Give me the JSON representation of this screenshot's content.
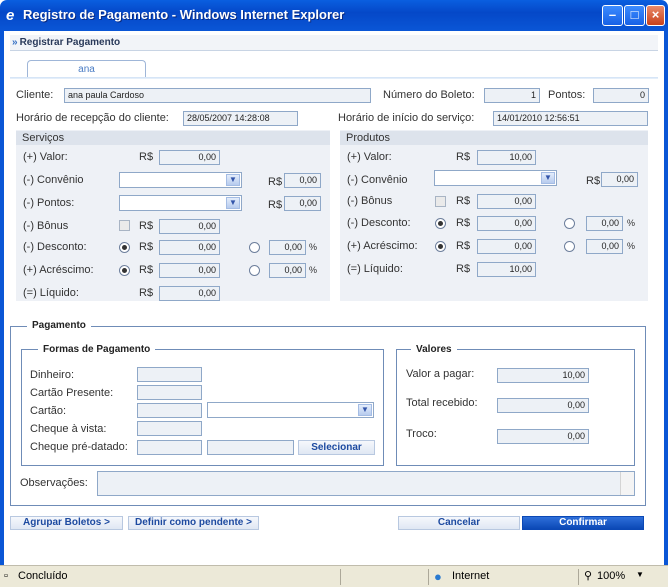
{
  "window": {
    "title": "Registro de Pagamento - Windows Internet Explorer"
  },
  "breadcrumb": "Registrar Pagamento",
  "tab": "ana",
  "header": {
    "cliente_label": "Cliente:",
    "cliente_value": "ana paula Cardoso",
    "boleto_label": "Número do Boleto:",
    "boleto_value": "1",
    "pontos_label": "Pontos:",
    "pontos_value": "0",
    "recepcao_label": "Horário de recepção do cliente:",
    "recepcao_value": "28/05/2007 14:28:08",
    "inicio_label": "Horário de início do serviço:",
    "inicio_value": "14/01/2010 12:56:51"
  },
  "servicos": {
    "title": "Serviços",
    "valor_label": "(+) Valor:",
    "valor_value": "0,00",
    "convenio_label": "(-) Convênio",
    "convenio_value": "0,00",
    "pontos_label": "(-) Pontos:",
    "pontos_value": "0,00",
    "bonus_label": "(-) Bônus",
    "bonus_value": "0,00",
    "desconto_label": "(-) Desconto:",
    "desconto_value": "0,00",
    "desconto_pct": "0,00",
    "acrescimo_label": "(+) Acréscimo:",
    "acrescimo_value": "0,00",
    "acrescimo_pct": "0,00",
    "liquido_label": "(=) Líquido:",
    "liquido_value": "0,00"
  },
  "produtos": {
    "title": "Produtos",
    "valor_label": "(+) Valor:",
    "valor_value": "10,00",
    "convenio_label": "(-) Convênio",
    "convenio_value": "0,00",
    "bonus_label": "(-) Bônus",
    "bonus_value": "0,00",
    "desconto_label": "(-) Desconto:",
    "desconto_value": "0,00",
    "desconto_pct": "0,00",
    "acrescimo_label": "(+) Acréscimo:",
    "acrescimo_value": "0,00",
    "acrescimo_pct": "0,00",
    "liquido_label": "(=) Líquido:",
    "liquido_value": "10,00"
  },
  "currency": "R$",
  "percent": "%",
  "pagamento": {
    "title": "Pagamento",
    "formas_title": "Formas de Pagamento",
    "dinheiro_label": "Dinheiro:",
    "cartao_presente_label": "Cartão Presente:",
    "cartao_label": "Cartão:",
    "cheque_vista_label": "Cheque à vista:",
    "cheque_pre_label": "Cheque pré-datado:",
    "selecionar_label": "Selecionar",
    "valores_title": "Valores",
    "valor_pagar_label": "Valor a pagar:",
    "valor_pagar_value": "10,00",
    "total_recebido_label": "Total recebido:",
    "total_recebido_value": "0,00",
    "troco_label": "Troco:",
    "troco_value": "0,00"
  },
  "observacoes_label": "Observações:",
  "buttons": {
    "agrupar": "Agrupar Boletos >",
    "pendente": "Definir como pendente >",
    "cancelar": "Cancelar",
    "confirmar": "Confirmar"
  },
  "statusbar": {
    "status": "Concluído",
    "zone": "Internet",
    "zoom": "100%"
  }
}
